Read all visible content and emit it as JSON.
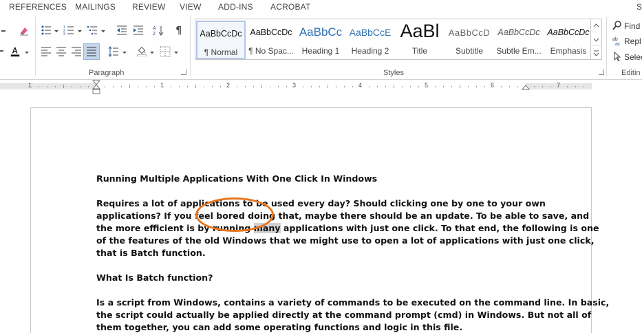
{
  "menu": {
    "tabs": [
      "REFERENCES",
      "MAILINGS",
      "REVIEW",
      "VIEW",
      "ADD-INS",
      "ACROBAT"
    ],
    "right_fragment": "S"
  },
  "ribbon": {
    "paragraph_label": "Paragraph",
    "styles_label": "Styles",
    "editing_label": "Editin",
    "styles": [
      {
        "sample": "AaBbCcDc",
        "name": "¶ Normal",
        "selected": true
      },
      {
        "sample": "AaBbCcDc",
        "name": "¶ No Spac..."
      },
      {
        "sample": "AaBbCc",
        "name": "Heading 1"
      },
      {
        "sample": "AaBbCcE",
        "name": "Heading 2"
      },
      {
        "sample": "AaBl",
        "name": "Title"
      },
      {
        "sample": "AaBbCcD",
        "name": "Subtitle"
      },
      {
        "sample": "AaBbCcDc",
        "name": "Subtle Em..."
      },
      {
        "sample": "AaBbCcDc",
        "name": "Emphasis"
      }
    ],
    "editing": {
      "find": "Find",
      "replace": "Repl",
      "select": "Selec"
    },
    "icons": [
      "clear-formatting-icon",
      "bullets-icon",
      "numbering-icon",
      "multilevel-list-icon",
      "decrease-indent-icon",
      "increase-indent-icon",
      "sort-icon",
      "show-formatting-marks-icon",
      "font-color-icon",
      "align-left-icon",
      "center-icon",
      "align-right-icon",
      "justify-icon",
      "line-spacing-icon",
      "shading-icon",
      "borders-icon",
      "find-icon",
      "replace-icon",
      "select-icon"
    ]
  },
  "ruler": {
    "numbers": [
      "1",
      "1",
      "2",
      "3",
      "4",
      "5",
      "6",
      "7"
    ]
  },
  "document": {
    "title": "Running Multiple Applications With One Click In Windows",
    "p1": {
      "l1": "Requires a lot of applications to be used every day? Should clicking one by one to your own",
      "l2": "applications? If you feel bored doing that, maybe there should be an update. To be able to save, and",
      "l3a": "the more efficient is by running ",
      "l3b": "many",
      "l3c": " applications with just one click. To that end, the following is one",
      "l4": "of the features of the old Windows that we might use to open a lot of applications with just one click,",
      "l5": "that is Batch function."
    },
    "heading2": "What Is Batch function?",
    "p2": {
      "l1": "Is a script from Windows, contains a variety of commands to be executed on the command line. In basic,",
      "l2": "the script could actually be applied directly at the command prompt (cmd) in Windows. But not all of",
      "l3": "them together, you can add some operating functions and logic in this file."
    }
  },
  "colors": {
    "annotation": "#e8761f",
    "spell_blue": "#3355dd",
    "spell_red": "#d02020",
    "selection": "#d0d0d0"
  }
}
